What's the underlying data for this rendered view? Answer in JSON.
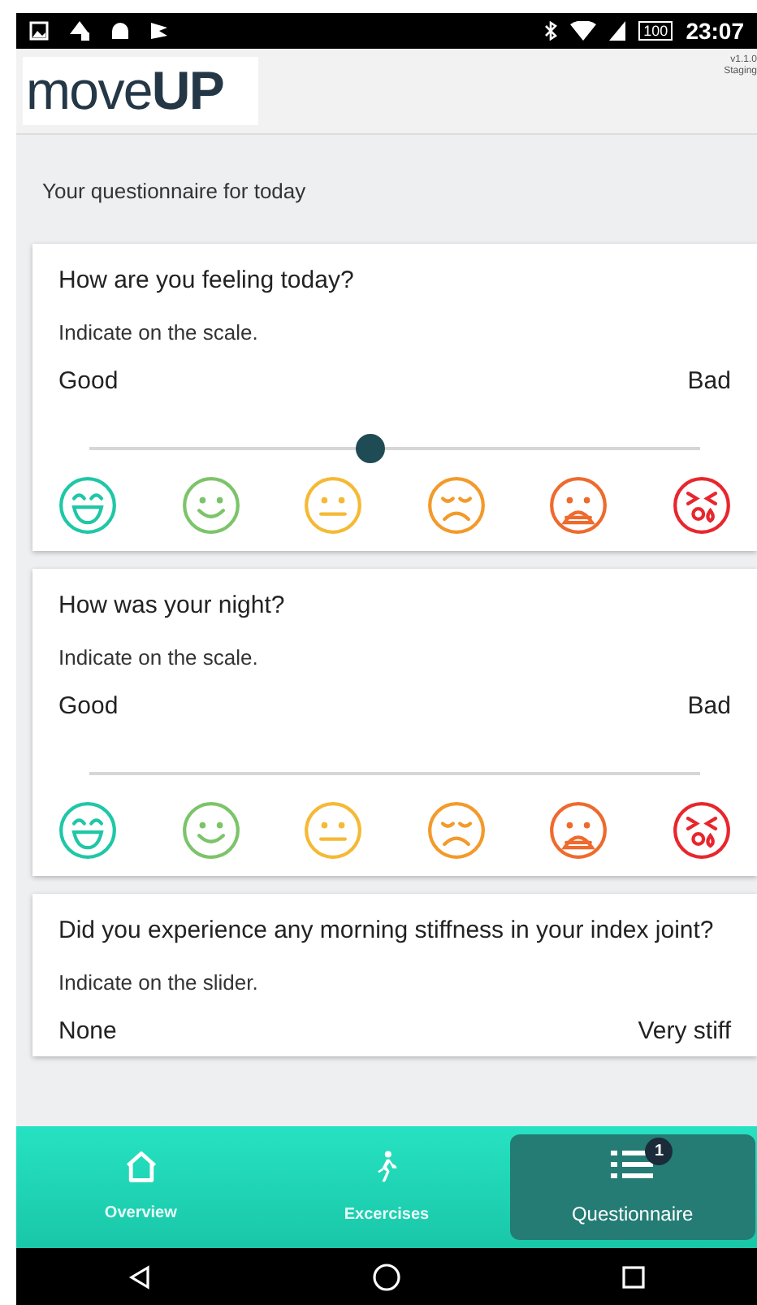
{
  "status_bar": {
    "battery": "100",
    "time": "23:07"
  },
  "header": {
    "logo_light": "move",
    "logo_bold": "UP",
    "version": "v1.1.0",
    "environment": "Staging"
  },
  "intro": "Your questionnaire for today",
  "questions": [
    {
      "title": "How are you feeling today?",
      "hint": "Indicate on the scale.",
      "low_label": "Good",
      "high_label": "Bad",
      "level": 0.46,
      "faces": [
        {
          "kind": "laugh",
          "color": "#1fc7a7"
        },
        {
          "kind": "smile",
          "color": "#7cc46a"
        },
        {
          "kind": "neutral",
          "color": "#f5b935"
        },
        {
          "kind": "sad",
          "color": "#f39a2b"
        },
        {
          "kind": "upset",
          "color": "#ee6a2d"
        },
        {
          "kind": "crying",
          "color": "#e8262d"
        }
      ]
    },
    {
      "title": "How was your night?",
      "hint": "Indicate on the scale.",
      "low_label": "Good",
      "high_label": "Bad",
      "faces": [
        {
          "kind": "laugh",
          "color": "#1fc7a7"
        },
        {
          "kind": "smile",
          "color": "#7cc46a"
        },
        {
          "kind": "neutral",
          "color": "#f5b935"
        },
        {
          "kind": "sad",
          "color": "#f39a2b"
        },
        {
          "kind": "upset",
          "color": "#ee6a2d"
        },
        {
          "kind": "crying",
          "color": "#e8262d"
        }
      ]
    },
    {
      "title": "Did you experience any morning stiffness in your index joint?",
      "hint": "Indicate on the slider.",
      "low_label": "None",
      "high_label": "Very stiff"
    }
  ],
  "nav": [
    {
      "kind": "home",
      "label": "Overview",
      "selected": false
    },
    {
      "kind": "walk",
      "label": "Excercises",
      "selected": false
    },
    {
      "kind": "list",
      "label": "Questionnaire",
      "selected": true,
      "badge": "1"
    }
  ]
}
